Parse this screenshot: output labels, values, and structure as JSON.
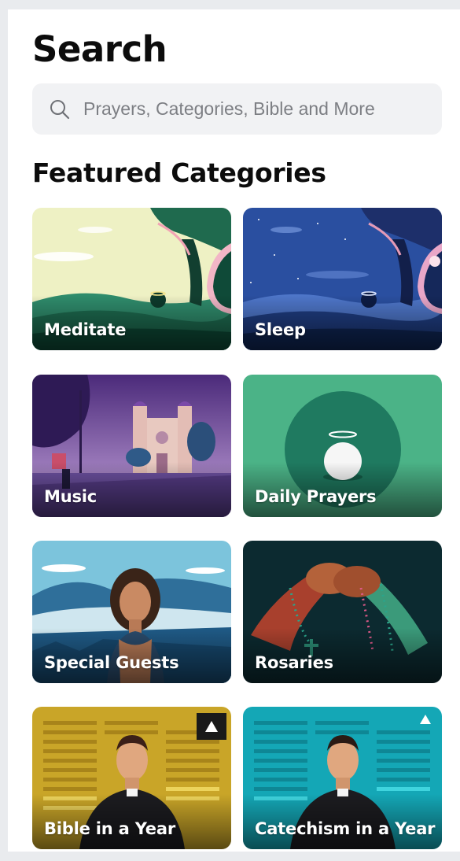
{
  "header": {
    "title": "Search"
  },
  "search": {
    "placeholder": "Prayers, Categories, Bible and More"
  },
  "featured": {
    "title": "Featured Categories",
    "categories": [
      {
        "label": "Meditate",
        "icon": "meditate-art"
      },
      {
        "label": "Sleep",
        "icon": "sleep-art"
      },
      {
        "label": "Music",
        "icon": "music-art"
      },
      {
        "label": "Daily Prayers",
        "icon": "daily-prayers-art"
      },
      {
        "label": "Special Guests",
        "icon": "special-guests-art"
      },
      {
        "label": "Rosaries",
        "icon": "rosaries-art"
      },
      {
        "label": "Bible in a Year",
        "icon": "bible-in-a-year-art"
      },
      {
        "label": "Catechism in a Year",
        "icon": "catechism-in-a-year-art"
      }
    ]
  },
  "colors": {
    "background": "#ffffff",
    "search_field": "#f1f2f4",
    "title_text": "#0c0c0c",
    "meditate_green": "#1f6a4e",
    "sleep_blue": "#2a4fa0",
    "daily_prayers_green": "#4bb387",
    "bible_gold": "#c9a528",
    "catechism_teal": "#14a7b6"
  }
}
